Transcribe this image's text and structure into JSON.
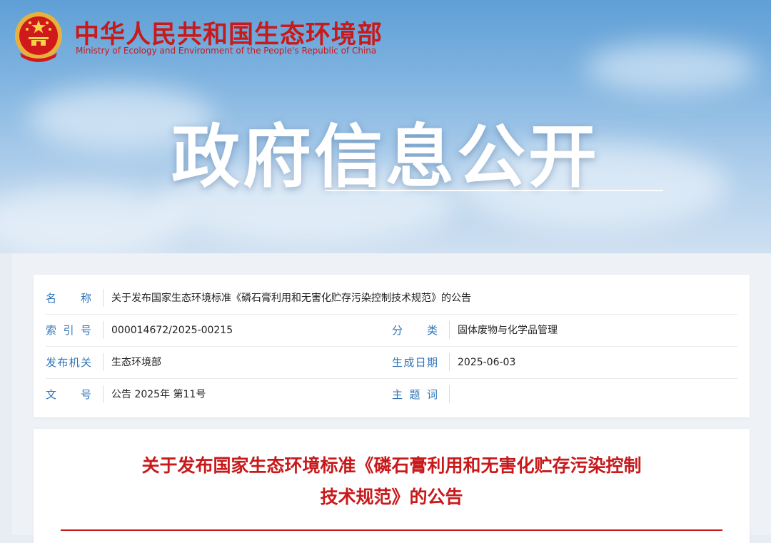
{
  "header": {
    "ministry_cn": "中华人民共和国生态环境部",
    "ministry_en": "Ministry of Ecology and Environment of the People's Republic of China",
    "hero_title": "政府信息公开"
  },
  "meta": {
    "name_label": "名　称",
    "name_value": "关于发布国家生态环境标准《磷石膏利用和无害化贮存污染控制技术规范》的公告",
    "index_label": "索引号",
    "index_value": "000014672/2025-00215",
    "category_label": "分　类",
    "category_value": "固体废物与化学品管理",
    "issuer_label": "发布机关",
    "issuer_value": "生态环境部",
    "date_label": "生成日期",
    "date_value": "2025-06-03",
    "docno_label": "文　号",
    "docno_value": "公告 2025年 第11号",
    "topic_label": "主题词",
    "topic_value": ""
  },
  "document": {
    "title_line1": "关于发布国家生态环境标准《磷石膏利用和无害化贮存污染控制",
    "title_line2": "技术规范》的公告"
  },
  "colors": {
    "brand_red": "#c8191b",
    "label_blue": "#2f74b8"
  }
}
